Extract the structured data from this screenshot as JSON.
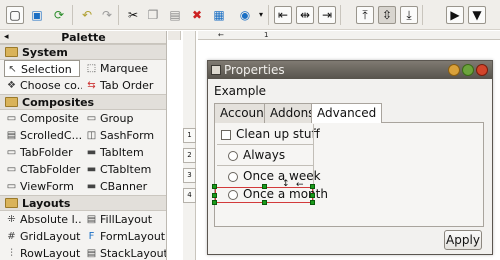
{
  "toolbar": {
    "icons": [
      "new-icon",
      "refresh-icon",
      "undo-icon",
      "redo-icon",
      "cut-icon",
      "copy-icon",
      "paste-icon",
      "delete-icon",
      "preview-icon",
      "globe-icon",
      "align-left-icon",
      "align-center-icon",
      "align-right-icon",
      "align-top-icon",
      "align-middle-icon",
      "align-bottom-icon",
      "size-width-icon",
      "size-height-icon"
    ]
  },
  "palette": {
    "title": "Palette",
    "categories": {
      "system": "System",
      "composites": "Composites",
      "layouts": "Layouts"
    },
    "system_items": [
      "Selection",
      "Marquee",
      "Choose co...",
      "Tab Order"
    ],
    "composite_items": [
      "Composite",
      "Group",
      "ScrolledC...",
      "SashForm",
      "TabFolder",
      "TabItem",
      "CTabFolder",
      "CTabItem",
      "ViewForm",
      "CBanner"
    ],
    "layout_items": [
      "Absolute l...",
      "FillLayout",
      "GridLayout",
      "FormLayout",
      "RowLayout",
      "StackLayout"
    ]
  },
  "ruler": {
    "top_marks": [
      "1"
    ],
    "side_marks": [
      "1",
      "2",
      "3",
      "4"
    ]
  },
  "window": {
    "title": "Properties",
    "label": "Example",
    "tabs": [
      "Account",
      "Addons",
      "Advanced"
    ],
    "active_tab": "Advanced",
    "checkbox_label": "Clean up stuff",
    "radios": [
      "Always",
      "Once a week",
      "Once a month"
    ],
    "apply_label": "Apply"
  },
  "colors": {
    "titlebar": "#57534c",
    "selection_handle": "#1a9b1a",
    "selection_border": "#d23a3a"
  }
}
